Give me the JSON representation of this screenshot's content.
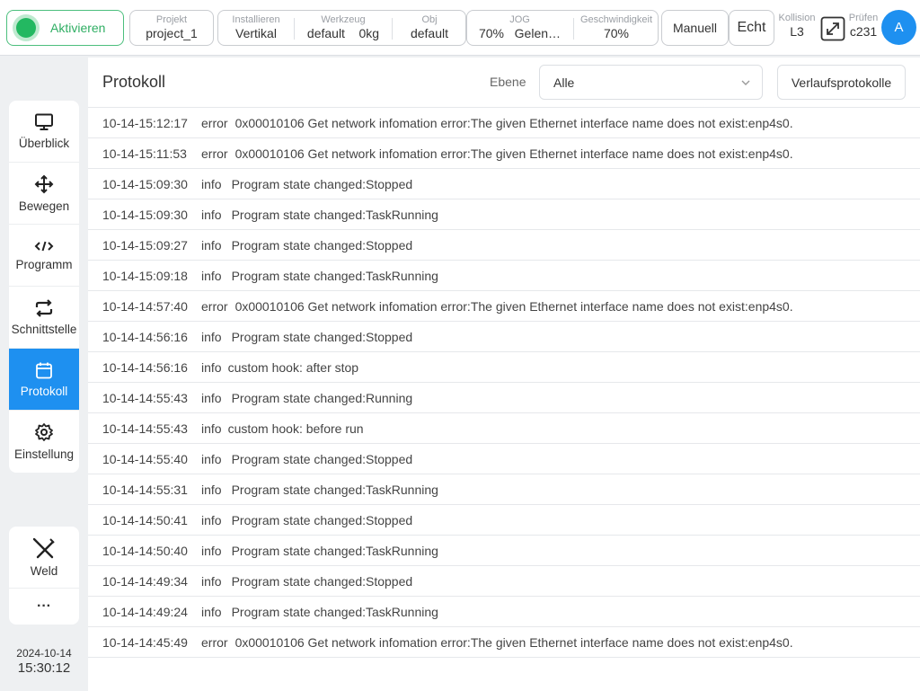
{
  "topbar": {
    "activate_label": "Aktivieren",
    "project": {
      "title": "Projekt",
      "value": "project_1"
    },
    "install": {
      "title": "Installieren",
      "value": "Vertikal"
    },
    "tool": {
      "title": "Werkzeug",
      "value": "default",
      "weight": "0kg"
    },
    "obj": {
      "title": "Obj",
      "value": "default"
    },
    "jog": {
      "title": "JOG",
      "value": "70%",
      "mode": "Gelen…"
    },
    "speed": {
      "title": "Geschwindigkeit",
      "value": "70%"
    },
    "manual_label": "Manuell",
    "real_label": "Echt",
    "collision": {
      "title": "Kollision",
      "value": "L3"
    },
    "check": {
      "title": "Prüfen",
      "value": "c231"
    },
    "avatar_letter": "A"
  },
  "sidebar": {
    "items": [
      {
        "label": "Überblick",
        "icon": "monitor-icon"
      },
      {
        "label": "Bewegen",
        "icon": "move-icon"
      },
      {
        "label": "Programm",
        "icon": "code-icon"
      },
      {
        "label": "Schnittstelle",
        "icon": "swap-icon"
      },
      {
        "label": "Protokoll",
        "icon": "calendar-icon",
        "active": true
      },
      {
        "label": "Einstellung",
        "icon": "gear-icon"
      }
    ],
    "weld_label": "Weld",
    "more_label": "···",
    "date": "2024-10-14",
    "time": "15:30:12"
  },
  "log_panel": {
    "title": "Protokoll",
    "level_label": "Ebene",
    "level_value": "Alle",
    "history_button": "Verlaufsprotokolle",
    "rows": [
      {
        "time": "10-14-15:12:17",
        "level": "error",
        "message": "0x00010106 Get network infomation error:The given Ethernet interface name does not exist:enp4s0."
      },
      {
        "time": "10-14-15:11:53",
        "level": "error",
        "message": "0x00010106 Get network infomation error:The given Ethernet interface name does not exist:enp4s0."
      },
      {
        "time": "10-14-15:09:30",
        "level": "info",
        "message": "Program state changed:Stopped"
      },
      {
        "time": "10-14-15:09:30",
        "level": "info",
        "message": "Program state changed:TaskRunning"
      },
      {
        "time": "10-14-15:09:27",
        "level": "info",
        "message": "Program state changed:Stopped"
      },
      {
        "time": "10-14-15:09:18",
        "level": "info",
        "message": "Program state changed:TaskRunning"
      },
      {
        "time": "10-14-14:57:40",
        "level": "error",
        "message": "0x00010106 Get network infomation error:The given Ethernet interface name does not exist:enp4s0."
      },
      {
        "time": "10-14-14:56:16",
        "level": "info",
        "message": "Program state changed:Stopped"
      },
      {
        "time": "10-14-14:56:16",
        "level": "info",
        "message": "custom hook: after stop"
      },
      {
        "time": "10-14-14:55:43",
        "level": "info",
        "message": "Program state changed:Running"
      },
      {
        "time": "10-14-14:55:43",
        "level": "info",
        "message": "custom hook: before run"
      },
      {
        "time": "10-14-14:55:40",
        "level": "info",
        "message": "Program state changed:Stopped"
      },
      {
        "time": "10-14-14:55:31",
        "level": "info",
        "message": "Program state changed:TaskRunning"
      },
      {
        "time": "10-14-14:50:41",
        "level": "info",
        "message": "Program state changed:Stopped"
      },
      {
        "time": "10-14-14:50:40",
        "level": "info",
        "message": "Program state changed:TaskRunning"
      },
      {
        "time": "10-14-14:49:34",
        "level": "info",
        "message": "Program state changed:Stopped"
      },
      {
        "time": "10-14-14:49:24",
        "level": "info",
        "message": "Program state changed:TaskRunning"
      },
      {
        "time": "10-14-14:45:49",
        "level": "error",
        "message": "0x00010106 Get network infomation error:The given Ethernet interface name does not exist:enp4s0."
      }
    ]
  },
  "colors": {
    "accent": "#1e90f0",
    "active_green": "#23b861"
  }
}
